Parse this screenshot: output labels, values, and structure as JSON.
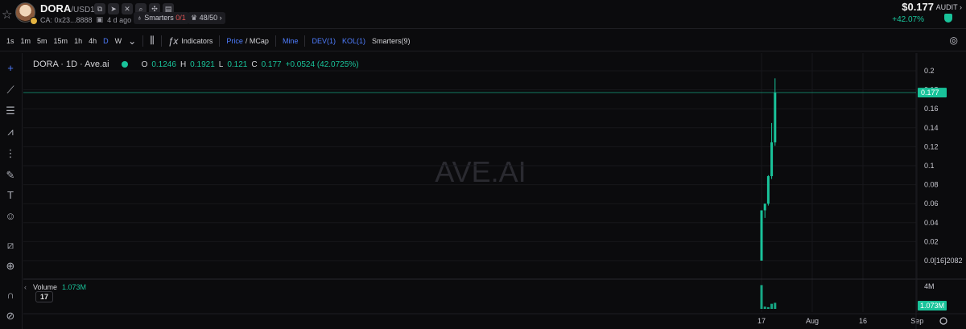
{
  "header": {
    "token_symbol": "DORA",
    "pair_quote": "/USD1",
    "social_icons": [
      "copy-icon",
      "telegram-icon",
      "x-icon",
      "search-icon",
      "bubblemaps-icon",
      "explorer-icon"
    ],
    "contract": "CA: 0x23...8888",
    "age": "4 d ago",
    "smarters_label": "Smarters",
    "smarters_value": "0/1",
    "holders_label": "48/50",
    "price": "$0.177",
    "change": "+42.07%",
    "audit_label": "AUDIT"
  },
  "toolbar": {
    "intervals": [
      {
        "label": "1s",
        "active": false
      },
      {
        "label": "1m",
        "active": false
      },
      {
        "label": "5m",
        "active": false
      },
      {
        "label": "15m",
        "active": false
      },
      {
        "label": "1h",
        "active": false
      },
      {
        "label": "4h",
        "active": false
      },
      {
        "label": "D",
        "active": true
      },
      {
        "label": "W",
        "active": false
      }
    ],
    "indicators_label": "Indicators",
    "price_label": "Price",
    "mcap_label": "/ MCap",
    "mine_label": "Mine",
    "dev_label": "DEV(1)",
    "kol_label": "KOL(1)",
    "smarters_label": "Smarters(9)"
  },
  "tools": [
    "crosshair-icon",
    "trend-line-icon",
    "fib-retracement-icon",
    "pattern-icon",
    "projection-icon",
    "brush-icon",
    "text-icon",
    "emoji-icon",
    "ruler-icon",
    "zoom-in-icon",
    "magnet-icon",
    "lock-icon"
  ],
  "legend": {
    "title": "DORA · 1D · Ave.ai",
    "o_key": "O",
    "o": "0.1246",
    "h_key": "H",
    "h": "0.1921",
    "l_key": "L",
    "l": "0.121",
    "c_key": "C",
    "c": "0.177",
    "change": "+0.0524 (42.0725%)"
  },
  "watermark": "AVE.AI",
  "volume_legend": {
    "label": "Volume",
    "value": "1.073M"
  },
  "chart_data": {
    "type": "candlestick",
    "title": "DORA · 1D · Ave.ai",
    "price_axis": {
      "ticks": [
        "0.2",
        "0.18",
        "0.16",
        "0.14",
        "0.12",
        "0.1",
        "0.08",
        "0.06",
        "0.04",
        "0.02",
        "0.0[16]2082"
      ],
      "tick_values": [
        0.2,
        0.18,
        0.16,
        0.14,
        0.12,
        0.1,
        0.08,
        0.06,
        0.04,
        0.02,
        0.0
      ],
      "range": [
        0,
        0.2
      ],
      "last_price_label": "0.177",
      "last_price": 0.177
    },
    "volume_axis": {
      "ticks": [
        "4M"
      ],
      "tick_values": [
        4000000
      ],
      "range": [
        0,
        4400000
      ],
      "last_volume_label": "1.073M",
      "last_volume": 1073000
    },
    "time_axis": {
      "labels": [
        "17",
        "Aug",
        "16",
        "Sep"
      ],
      "day_index": [
        0,
        15,
        30,
        46
      ]
    },
    "candles": [
      {
        "day": 0,
        "o": 0.0,
        "h": 0.0,
        "l": 0.0,
        "c": 0.053,
        "v": 4200000
      },
      {
        "day": 1,
        "o": 0.053,
        "h": 0.06,
        "l": 0.045,
        "c": 0.06,
        "v": 400000
      },
      {
        "day": 2,
        "o": 0.06,
        "h": 0.09,
        "l": 0.058,
        "c": 0.089,
        "v": 300000
      },
      {
        "day": 3,
        "o": 0.089,
        "h": 0.145,
        "l": 0.086,
        "c": 0.1246,
        "v": 900000
      },
      {
        "day": 4,
        "o": 0.1246,
        "h": 0.1921,
        "l": 0.121,
        "c": 0.177,
        "v": 1073000
      }
    ],
    "colors": {
      "up": "#19c39a",
      "down": "#e05555",
      "grid": "#17171b",
      "axis_text": "#c8c8d0"
    }
  }
}
